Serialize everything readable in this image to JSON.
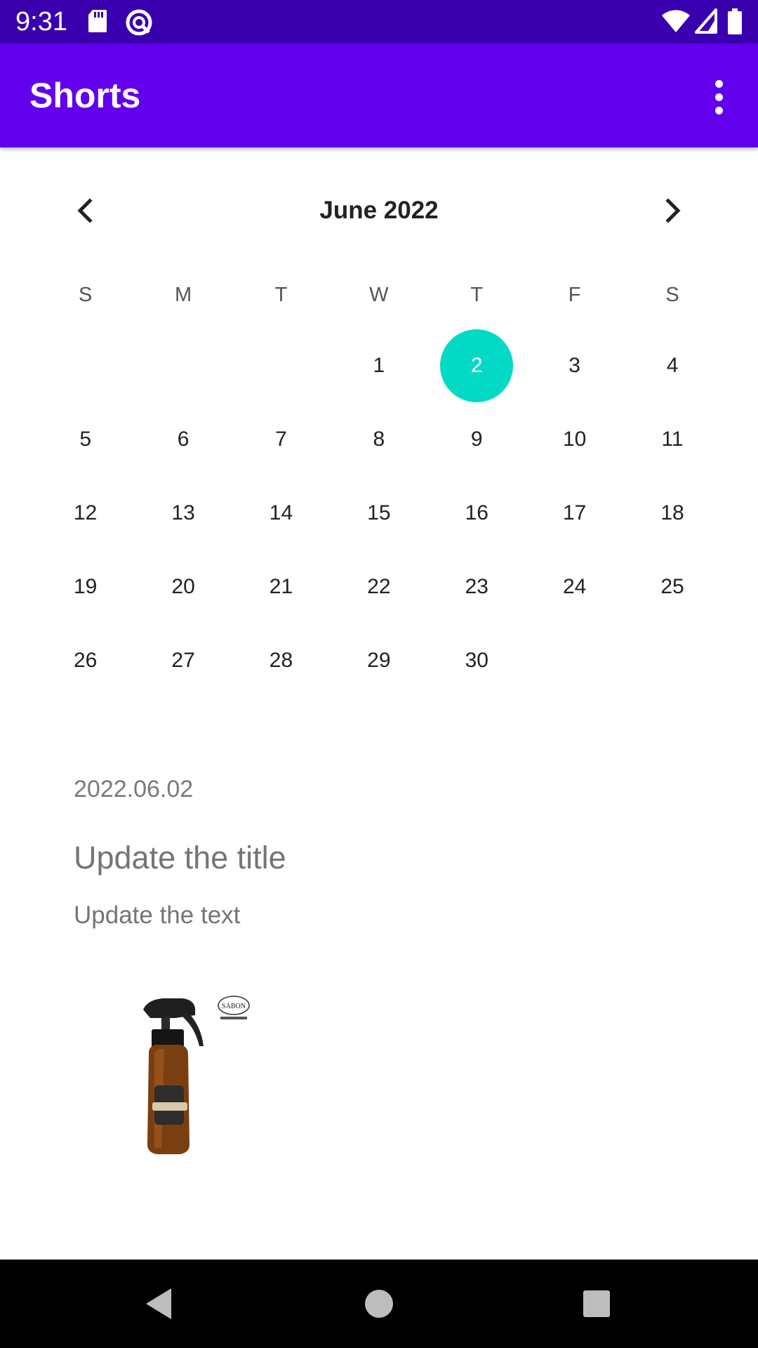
{
  "status_bar": {
    "time": "9:31",
    "icons": [
      "sd-card-icon",
      "sync-icon",
      "wifi-icon",
      "cell-signal-icon",
      "battery-icon"
    ]
  },
  "app_bar": {
    "title": "Shorts",
    "menu_icon": "more-vert-icon"
  },
  "colors": {
    "status_bar": "#3a00b0",
    "app_bar": "#6200ee",
    "selected_day": "#03dac5"
  },
  "calendar": {
    "month_label": "June 2022",
    "prev_icon": "chevron-left-icon",
    "next_icon": "chevron-right-icon",
    "weekdays": [
      "S",
      "M",
      "T",
      "W",
      "T",
      "F",
      "S"
    ],
    "selected_day": "2",
    "weeks": [
      [
        "",
        "",
        "",
        "1",
        "2",
        "3",
        "4"
      ],
      [
        "5",
        "6",
        "7",
        "8",
        "9",
        "10",
        "11"
      ],
      [
        "12",
        "13",
        "14",
        "15",
        "16",
        "17",
        "18"
      ],
      [
        "19",
        "20",
        "21",
        "22",
        "23",
        "24",
        "25"
      ],
      [
        "26",
        "27",
        "28",
        "29",
        "30",
        "",
        ""
      ]
    ]
  },
  "entry": {
    "date": "2022.06.02",
    "title": "Update the title",
    "text": "Update the text",
    "image_icon": "spray-bottle-image",
    "brand_mark": "SABON"
  },
  "nav_bar": {
    "icons": [
      "back-icon",
      "home-icon",
      "recents-icon"
    ]
  }
}
